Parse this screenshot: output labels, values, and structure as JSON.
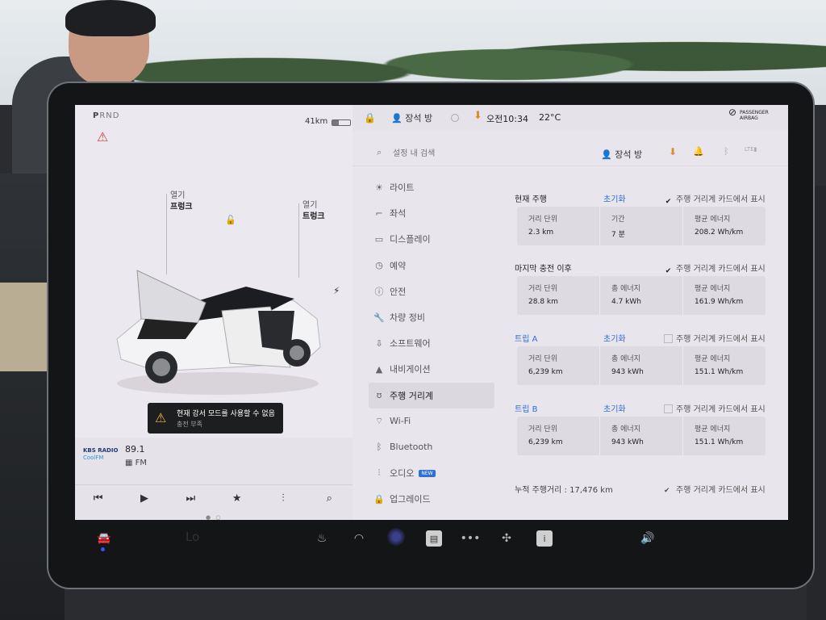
{
  "status": {
    "gear": "PRND",
    "gear_active": "P",
    "range": "41km",
    "battery_level": 0.35,
    "time": "오전10:34",
    "temperature": "22°C",
    "profile": "장석 방",
    "airbag": "PASSENGER AIRBAG"
  },
  "car": {
    "frunk_action": "열기",
    "frunk_label": "프렁크",
    "trunk_action": "열기",
    "trunk_label": "트렁크"
  },
  "alert": {
    "title": "현재 강서 모드를 사용할 수 없음",
    "subtitle": "충전 부족"
  },
  "media": {
    "station_name": "KBS RADIO",
    "station_sub": "CoolFM",
    "frequency": "89.1",
    "band": "FM"
  },
  "search": {
    "placeholder": "설정 내 검색"
  },
  "settings_header": {
    "profile": "장석 방"
  },
  "menu": {
    "items": [
      {
        "icon": "light-icon",
        "label": "라이트"
      },
      {
        "icon": "seat-icon",
        "label": "좌석"
      },
      {
        "icon": "display-icon",
        "label": "디스플레이"
      },
      {
        "icon": "schedule-icon",
        "label": "예약"
      },
      {
        "icon": "safety-icon",
        "label": "안전"
      },
      {
        "icon": "wrench-icon",
        "label": "차량 정비"
      },
      {
        "icon": "download-icon",
        "label": "소프트웨어"
      },
      {
        "icon": "navigation-icon",
        "label": "내비게이션"
      },
      {
        "icon": "trip-icon",
        "label": "주행 거리계"
      },
      {
        "icon": "wifi-icon",
        "label": "Wi-Fi"
      },
      {
        "icon": "bluetooth-icon",
        "label": "Bluetooth"
      },
      {
        "icon": "audio-icon",
        "label": "오디오",
        "badge": "NEW"
      },
      {
        "icon": "upgrade-icon",
        "label": "업그레이드"
      }
    ],
    "active_index": 8
  },
  "trips": {
    "current": {
      "title": "현재 주행",
      "reset": "초기화",
      "show_label": "주행 거리계 카드에서 표시",
      "checked": true,
      "cols": [
        {
          "label": "거리 단위",
          "value": "2.3 km"
        },
        {
          "label": "기간",
          "value": "7 분"
        },
        {
          "label": "평균 에너지",
          "value": "208.2 Wh/km"
        }
      ]
    },
    "since_charge": {
      "title": "마지막 충전 이후",
      "show_label": "주행 거리계 카드에서 표시",
      "checked": true,
      "cols": [
        {
          "label": "거리 단위",
          "value": "28.8 km"
        },
        {
          "label": "총 에너지",
          "value": "4.7 kWh"
        },
        {
          "label": "평균 에너지",
          "value": "161.9 Wh/km"
        }
      ]
    },
    "trip_a": {
      "title": "트립 A",
      "reset": "초기화",
      "show_label": "주행 거리계 카드에서 표시",
      "checked": false,
      "cols": [
        {
          "label": "거리 단위",
          "value": "6,239 km"
        },
        {
          "label": "총 에너지",
          "value": "943 kWh"
        },
        {
          "label": "평균 에너지",
          "value": "151.1 Wh/km"
        }
      ]
    },
    "trip_b": {
      "title": "트립 B",
      "reset": "초기화",
      "show_label": "주행 거리계 카드에서 표시",
      "checked": false,
      "cols": [
        {
          "label": "거리 단위",
          "value": "6,239 km"
        },
        {
          "label": "총 에너지",
          "value": "943 kWh"
        },
        {
          "label": "평균 에너지",
          "value": "151.1 Wh/km"
        }
      ]
    },
    "odometer": {
      "label": "누적 주행거리 : 17,476 km",
      "show_label": "주행 거리계 카드에서 표시",
      "checked": true
    }
  },
  "dock": {
    "lo_label": "Lo"
  },
  "colors": {
    "accent": "#2e6fd8",
    "warning": "#f3b63b",
    "download": "#e08a2a",
    "seatbelt": "#d23a3a"
  }
}
